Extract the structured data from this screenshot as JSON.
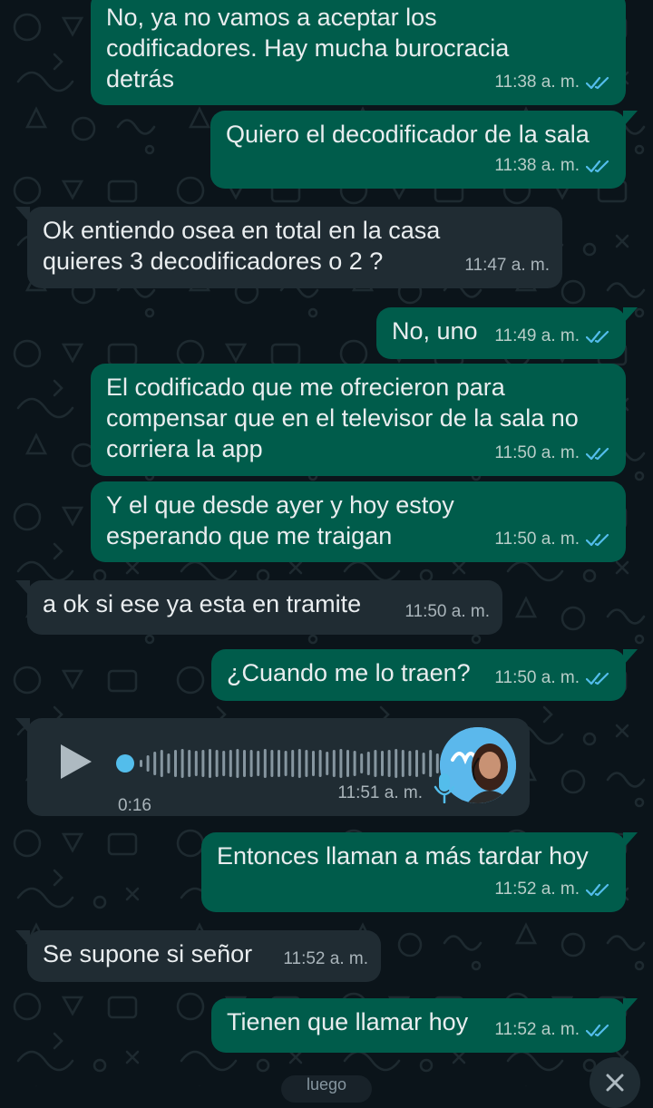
{
  "chat": {
    "messages": [
      {
        "direction": "out",
        "text": "No, ya no vamos a aceptar los\ncodificadores. Hay mucha burocracia\ndetrás",
        "time": "11:38 a. m.",
        "status": "read"
      },
      {
        "direction": "out",
        "text": "Quiero el decodificador de la sala",
        "time": "11:38 a. m.",
        "status": "read"
      },
      {
        "direction": "in",
        "text": "Ok entiendo osea en total en la casa\nquieres 3 decodificadores o 2 ?",
        "time": "11:47 a. m."
      },
      {
        "direction": "out",
        "text": "No, uno",
        "time": "11:49 a. m.",
        "status": "read"
      },
      {
        "direction": "out",
        "text": "El codificado que me ofrecieron para\ncompensar que en el televisor de la sala no\ncorriera la app",
        "time": "11:50 a. m.",
        "status": "read"
      },
      {
        "direction": "out",
        "text": "Y el que desde ayer y hoy estoy\nesperando que me traigan",
        "time": "11:50 a. m.",
        "status": "read"
      },
      {
        "direction": "in",
        "text": "a ok si ese ya esta en tramite",
        "time": "11:50 a. m."
      },
      {
        "direction": "out",
        "text": "¿Cuando me lo traen?",
        "time": "11:50 a. m.",
        "status": "read"
      },
      {
        "direction": "in",
        "type": "voice",
        "duration": "0:16",
        "time": "11:51 a. m.",
        "progress": 0
      },
      {
        "direction": "out",
        "text": "Entonces llaman a más tardar hoy",
        "time": "11:52 a. m.",
        "status": "read"
      },
      {
        "direction": "in",
        "text": "Se supone si señor",
        "time": "11:52 a. m."
      },
      {
        "direction": "out",
        "text": "Tienen que llamar hoy",
        "time": "11:52 a. m.",
        "status": "read"
      }
    ],
    "unread_pill": "luego",
    "colors": {
      "background": "#0b141a",
      "outgoing_bubble": "#005c4b",
      "incoming_bubble": "#202c33",
      "read_ticks": "#53bdeb",
      "voice_accent": "#53bdeb"
    },
    "icons": {
      "read_receipt": "double-check-icon",
      "play": "play-icon",
      "mic": "mic-icon",
      "scroll_down": "chevron-down-icon"
    }
  }
}
